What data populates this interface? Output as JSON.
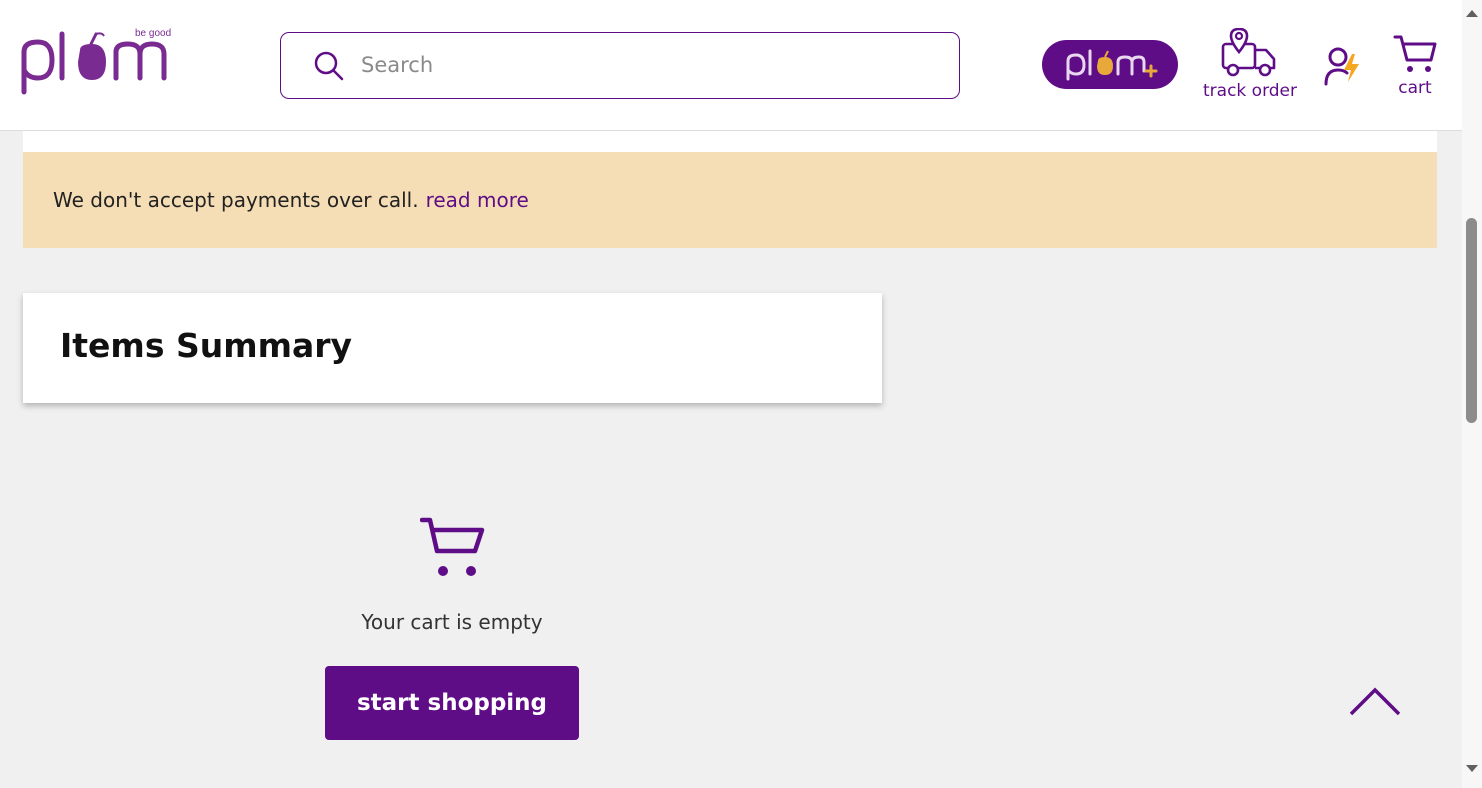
{
  "header": {
    "logo_text": "plum",
    "tagline": "be good",
    "search": {
      "placeholder": "Search",
      "value": ""
    },
    "plum_plus_label": "plum+",
    "track_order_label": "track order",
    "cart_label": "cart"
  },
  "banner": {
    "text": "We don't accept payments over call.",
    "link_text": "read more",
    "background": "#f5deb5"
  },
  "summary": {
    "title": "Items Summary"
  },
  "empty_cart": {
    "message": "Your cart is empty",
    "button_label": "start shopping"
  },
  "icons": {
    "search": "search-icon",
    "track_order": "truck-location-icon",
    "profile": "user-lightning-icon",
    "cart": "cart-icon",
    "scroll_top": "chevron-up-icon"
  },
  "colors": {
    "brand": "#5f0d87",
    "accent": "#f5a623",
    "page_bg": "#f0f0f0"
  }
}
